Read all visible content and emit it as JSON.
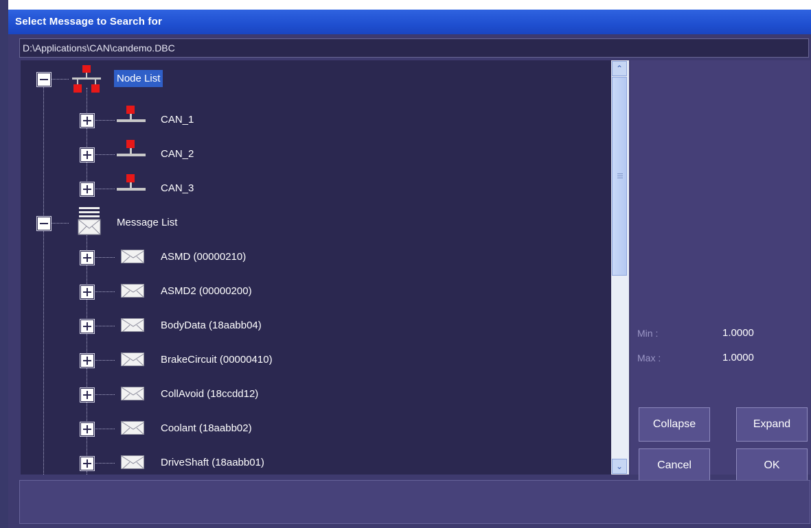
{
  "dialog": {
    "title": "Select Message to Search for",
    "file_path": "D:\\Applications\\CAN\\candemo.DBC"
  },
  "tree": {
    "node_list_label": "Node List",
    "nodes": [
      "CAN_1",
      "CAN_2",
      "CAN_3"
    ],
    "message_list_label": "Message List",
    "messages": [
      "ASMD (00000210)",
      "ASMD2 (00000200)",
      "BodyData (18aabb04)",
      "BrakeCircuit (00000410)",
      "CollAvoid (18ccdd12)",
      "Coolant (18aabb02)",
      "DriveShaft (18aabb01)"
    ]
  },
  "range": {
    "min_label": "Min :",
    "min_value": "1.0000",
    "max_label": "Max :",
    "max_value": "1.0000"
  },
  "buttons": {
    "collapse": "Collapse",
    "expand": "Expand",
    "cancel": "Cancel",
    "ok": "OK"
  },
  "scrollbar": {
    "up_glyph": "⌃",
    "down_glyph": "⌄"
  },
  "colors": {
    "title_bar": "#1f4fd0",
    "tree_background": "#2b2850",
    "selection": "#2f5fc8",
    "node_icon_red": "#e81818"
  }
}
